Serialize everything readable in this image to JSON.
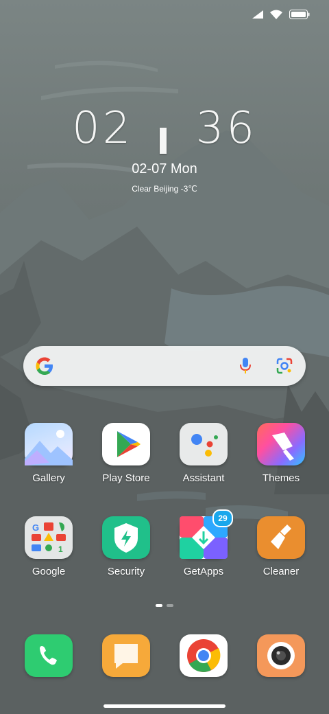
{
  "clock": {
    "time": "02 ╻ 36",
    "date": "02-07 Mon",
    "weather": "Clear Beijing -3℃"
  },
  "apps": [
    {
      "name": "Gallery",
      "icon": "gallery-icon"
    },
    {
      "name": "Play Store",
      "icon": "play-store-icon"
    },
    {
      "name": "Assistant",
      "icon": "assistant-icon"
    },
    {
      "name": "Themes",
      "icon": "themes-icon"
    },
    {
      "name": "Google",
      "icon": "google-folder-icon"
    },
    {
      "name": "Security",
      "icon": "security-icon"
    },
    {
      "name": "GetApps",
      "icon": "getapps-icon",
      "badge": "29"
    },
    {
      "name": "Cleaner",
      "icon": "cleaner-icon"
    }
  ],
  "dock": [
    {
      "icon": "phone-icon"
    },
    {
      "icon": "messages-icon"
    },
    {
      "icon": "chrome-icon"
    },
    {
      "icon": "camera-icon"
    }
  ],
  "colors": {
    "google_blue": "#4285F4",
    "google_red": "#EA4335",
    "google_yellow": "#FBBC05",
    "google_green": "#34A853",
    "phone_green": "#2ecc71",
    "security_green": "#20c08a",
    "cleaner_orange": "#ea8e2f"
  }
}
